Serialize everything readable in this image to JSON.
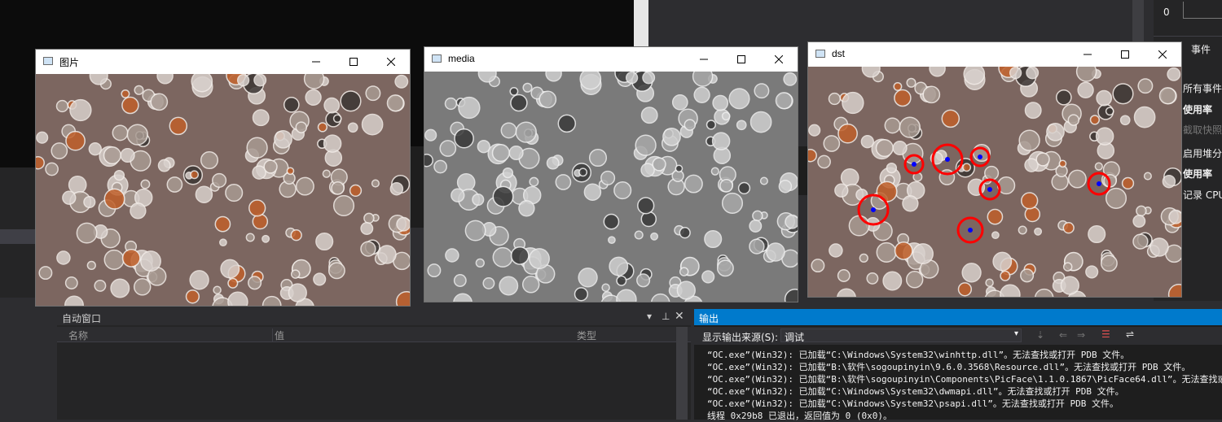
{
  "windows": [
    {
      "title": "图片"
    },
    {
      "title": "media"
    },
    {
      "title": "dst"
    }
  ],
  "diagnostics": {
    "zero_label": "0",
    "tab_events": "事件",
    "rows": [
      "所有事件",
      "使用率",
      "截取快照",
      "启用堆分",
      "使用率",
      "记录 CPU"
    ]
  },
  "autos": {
    "title": "自动窗口",
    "col_name": "名称",
    "col_value": "值",
    "col_type": "类型"
  },
  "output": {
    "title": "输出",
    "source_label": "显示输出来源(S):",
    "source_value": "调试",
    "lines": [
      "“OC.exe”(Win32): 已加载“C:\\Windows\\System32\\winhttp.dll”。无法查找或打开 PDB 文件。",
      "“OC.exe”(Win32): 已加载“B:\\软件\\sogoupinyin\\9.6.0.3568\\Resource.dll”。无法查找或打开 PDB 文件。",
      "“OC.exe”(Win32): 已加载“B:\\软件\\sogoupinyin\\Components\\PicFace\\1.1.0.1867\\PicFace64.dll”。无法查找或打",
      "“OC.exe”(Win32): 已加载“C:\\Windows\\System32\\dwmapi.dll”。无法查找或打开 PDB 文件。",
      "“OC.exe”(Win32): 已加载“C:\\Windows\\System32\\psapi.dll”。无法查找或打开 PDB 文件。",
      "线程 0x29b8 已退出，返回值为 0 (0x0)。"
    ]
  },
  "colors": {
    "accent": "#007acc",
    "marker_circle": "#ff0000",
    "marker_center": "#0000ff"
  },
  "icons": [
    "window-app-icon",
    "minimize-icon",
    "maximize-icon",
    "close-icon",
    "pin-icon",
    "chevron-down-icon"
  ]
}
